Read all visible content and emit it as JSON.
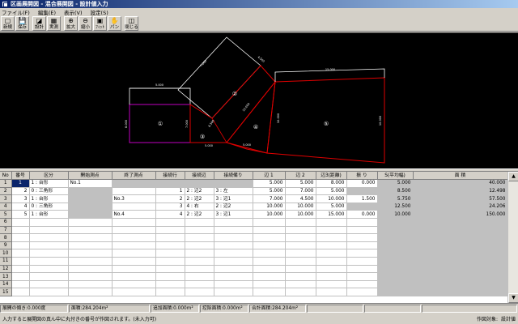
{
  "window": {
    "title": "区画展開図 - 混合展開図 - 設計値入力"
  },
  "menu": [
    "ファイル(F)",
    "編集(E)",
    "表示(V)",
    "設定(S)"
  ],
  "toolbar": [
    {
      "name": "new",
      "label": "新規",
      "icon": "▢"
    },
    {
      "name": "save",
      "label": "保存",
      "icon": "💾"
    },
    {
      "name": "design",
      "label": "設計",
      "icon": "◪"
    },
    {
      "name": "actual",
      "label": "実測",
      "icon": "▦"
    },
    {
      "name": "zoom-in",
      "label": "拡大",
      "icon": "⊕"
    },
    {
      "name": "zoom-out",
      "label": "縮小",
      "icon": "⊖"
    },
    {
      "name": "fit",
      "label": "ﾌｨｯﾄ",
      "icon": "▣"
    },
    {
      "name": "pan",
      "label": "パン",
      "icon": "✋"
    },
    {
      "name": "close",
      "label": "閉じる",
      "icon": "◫"
    }
  ],
  "drawing": {
    "labels": {
      "p1": "①",
      "p2": "②",
      "p3": "③",
      "p4": "④",
      "p5": "⑤",
      "d_top1": "5.000",
      "d_left1": "8.000",
      "d_right1": "7.000",
      "d_bot": "5.000",
      "d_diag1": "7.000",
      "d_diag2": "4.500",
      "d_diag3": "10.000",
      "d_top5": "15.000",
      "d_left5": "10.000",
      "d_right5": "10.000",
      "d_bot2": "5.000",
      "d_mid": "6.500"
    }
  },
  "table": {
    "headers": [
      "No",
      "番号",
      "区分",
      "開始測点",
      "終了測点",
      "接続行",
      "接続辺",
      "接続備り",
      "辺 1",
      "辺 2",
      "辺3(距離)",
      "振 り",
      "S(平均幅)",
      "面 積"
    ],
    "rows": [
      {
        "no": "1",
        "num": "1",
        "kubun": "1 : 台形",
        "start": "No.1",
        "end": "",
        "setsu": "",
        "henb": "",
        "bikou": "",
        "h1": "5.000",
        "h2": "5.000",
        "h3": "8.000",
        "furi": "0.000",
        "s": "5.000",
        "area": "40.000"
      },
      {
        "no": "2",
        "num": "2",
        "kubun": "0 : 三角形",
        "start": "",
        "end": "",
        "setsu": "1",
        "henb": "2 : 辺2",
        "bikou": "3 : 左",
        "h1": "5.000",
        "h2": "7.000",
        "h3": "5.000",
        "furi": "",
        "s": "8.500",
        "area": "12.498"
      },
      {
        "no": "3",
        "num": "3",
        "kubun": "1 : 台形",
        "start": "",
        "end": "No.3",
        "setsu": "2",
        "henb": "2 : 辺2",
        "bikou": "3 : 辺1",
        "h1": "7.000",
        "h2": "4.500",
        "h3": "10.000",
        "furi": "1.500",
        "s": "5.750",
        "area": "57.500"
      },
      {
        "no": "4",
        "num": "4",
        "kubun": "0 : 三角形",
        "start": "",
        "end": "",
        "setsu": "3",
        "henb": "4 : 右",
        "bikou": "2 : 辺2",
        "h1": "10.000",
        "h2": "10.000",
        "h3": "5.000",
        "furi": "",
        "s": "12.500",
        "area": "24.206"
      },
      {
        "no": "5",
        "num": "5",
        "kubun": "1 : 台形",
        "start": "",
        "end": "No.4",
        "setsu": "4",
        "henb": "2 : 辺2",
        "bikou": "3 : 辺1",
        "h1": "10.000",
        "h2": "10.000",
        "h3": "15.000",
        "furi": "0.000",
        "s": "10.000",
        "area": "150.000"
      }
    ],
    "empty_rows": [
      "6",
      "7",
      "8",
      "9",
      "10",
      "11",
      "12",
      "13",
      "14",
      "15"
    ]
  },
  "status": {
    "slope": "展開の傾き:0.000度",
    "area": "面積:284.204m²",
    "add_area": "追加面積:0.000m²",
    "deduct_area": "控除面積:0.000m²",
    "total_area": "合計面積:284.204m²"
  },
  "message": {
    "text": "入力すると展開図の真ん中に丸付きの番号が作図されます。(未入力可)",
    "target_label": "作図対象:",
    "target_value": "設計値"
  }
}
